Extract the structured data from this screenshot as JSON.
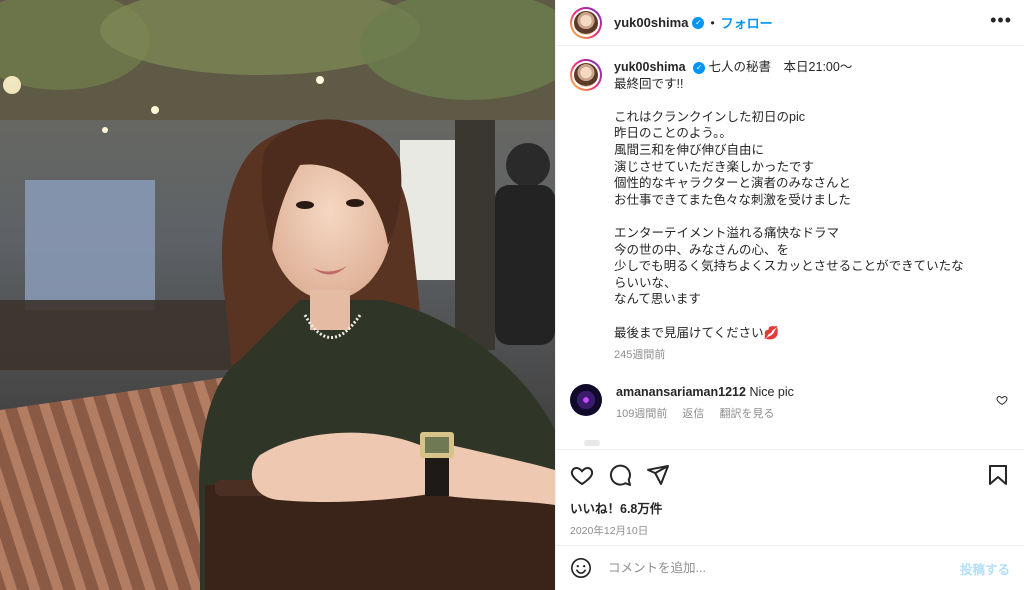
{
  "header": {
    "username": "yuk00shima",
    "separator": "•",
    "follow_label": "フォロー",
    "more_label": "•••"
  },
  "caption": {
    "username": "yuk00shima",
    "lines": [
      "七人の秘書　本日21:00〜",
      "最終回です!!",
      "",
      "これはクランクインした初日のpic",
      "昨日のことのよう。。",
      "風間三和を伸び伸び自由に",
      "演じさせていただき楽しかったです",
      "個性的なキャラクターと演者のみなさんと",
      "お仕事できてまた色々な刺激を受けました",
      "",
      "エンターテイメント溢れる痛快なドラマ",
      "今の世の中、みなさんの心、を",
      "少しでも明るく気持ちよくスカッとさせることができていたな",
      "らいいな、",
      "なんて思います",
      "",
      "最後まで見届けてください"
    ],
    "emoji": "💋",
    "time": "245週間前"
  },
  "comments": [
    {
      "username": "amanansariaman1212",
      "text": "Nice pic",
      "time": "109週間前",
      "reply_label": "返信",
      "translate_label": "翻訳を見る"
    }
  ],
  "actions": {
    "likes_text": "いいね！6.8万件",
    "date_text": "2020年12月10日"
  },
  "add_comment": {
    "placeholder": "コメントを追加...",
    "post_label": "投稿する"
  },
  "colors": {
    "accent": "#0095f6",
    "post_disabled": "#b2dffc",
    "muted": "#8e8e8e"
  },
  "icons": [
    "verified-icon",
    "more-icon",
    "heart-icon",
    "comment-icon",
    "share-icon",
    "save-icon",
    "emoji-icon"
  ]
}
